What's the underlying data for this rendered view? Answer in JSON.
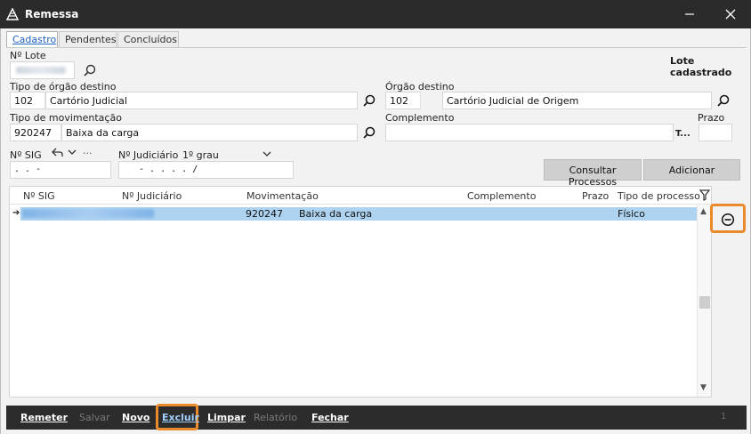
{
  "window": {
    "title": "Remessa"
  },
  "tabs": [
    {
      "label": "Cadastro"
    },
    {
      "label": "Pendentes"
    },
    {
      "label": "Concluídos"
    }
  ],
  "lote": {
    "label": "Nº Lote",
    "status": "Lote cadastrado"
  },
  "tipo_orgao": {
    "label": "Tipo de órgão destino",
    "code": "102",
    "name": "Cartório Judicial"
  },
  "orgao": {
    "label": "Órgão destino",
    "code": "102",
    "name": "Cartório Judicial de Origem"
  },
  "tipo_mov": {
    "label": "Tipo de movimentação",
    "code": "920247",
    "name": "Baixa da carga"
  },
  "complemento": {
    "label": "Complemento",
    "value": "",
    "t_button": "T..."
  },
  "prazo": {
    "label": "Prazo",
    "value": ""
  },
  "sig": {
    "label": "Nº SIG",
    "mask": " .   .   -",
    "more": "···"
  },
  "judiciario": {
    "label": "Nº Judiciário",
    "grau": "1º grau",
    "mask": "-   .   .   .   .   /"
  },
  "buttons": {
    "consultar": "Consultar Processos",
    "adicionar": "Adicionar"
  },
  "grid": {
    "columns": [
      "Nº SIG",
      "Nº Judiciário",
      "Movimentação",
      "Complemento",
      "Prazo",
      "Tipo de processo"
    ],
    "rows": [
      {
        "mov_code": "920247",
        "mov_name": "Baixa da carga",
        "tipo": "Físico"
      }
    ]
  },
  "footer": {
    "remeter": "Remeter",
    "salvar": "Salvar",
    "novo": "Novo",
    "excluir": "Excluir",
    "limpar": "Limpar",
    "relatorio": "Relatório",
    "fechar": "Fechar",
    "page": "1"
  },
  "colors": {
    "accent": "#ea8a2a",
    "selection": "#aed3f0",
    "titlebar": "#2b2b2b"
  }
}
